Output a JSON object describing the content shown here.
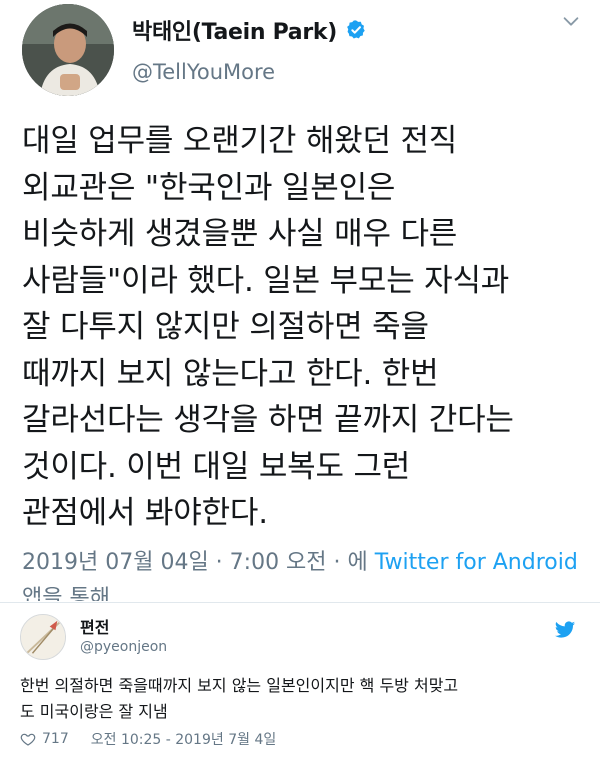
{
  "tweet": {
    "display_name": "박태인(Taein Park)",
    "handle": "@TellYouMore",
    "text": "대일 업무를 오랜기간 해왔던 전직\n외교관은 \"한국인과 일본인은\n비슷하게 생겼을뿐 사실 매우 다른\n사람들\"이라 했다. 일본 부모는 자식과\n잘 다투지 않지만 의절하면 죽을\n때까지 보지 않는다고 한다. 한번\n갈라선다는 생각을 하면 끝까지 간다는\n것이다. 이번 대일 보복도 그런\n관점에서 봐야한다.",
    "date_time": "2019년 07월 04일 · 7:00 오전 · 에 ",
    "source": "Twitter for Android",
    "source_suffix": " 앱을 통해"
  },
  "embed": {
    "display_name": "편전",
    "handle": "@pyeonjeon",
    "text": "한번 의절하면 죽을때까지 보지 않는 일본인이지만 핵 두방 처맞고\n도 미국이랑은 잘 지냄",
    "likes": "717",
    "timestamp": "오전 10:25 - 2019년 7월 4일"
  },
  "icons": {
    "verified": "verified-badge-icon",
    "caret": "chevron-down-icon",
    "bird": "twitter-bird-icon",
    "heart": "heart-icon"
  },
  "colors": {
    "accent": "#1da1f2",
    "muted": "#657786",
    "text": "#14171a"
  }
}
